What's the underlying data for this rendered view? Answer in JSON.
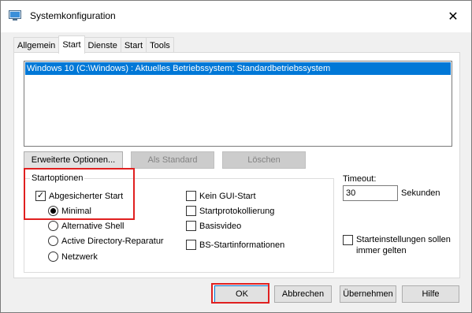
{
  "window": {
    "title": "Systemkonfiguration",
    "icon": "msconfig-icon"
  },
  "tabs": [
    {
      "label": "Allgemein",
      "active": false
    },
    {
      "label": "Start",
      "active": true
    },
    {
      "label": "Dienste",
      "active": false
    },
    {
      "label": "Start",
      "active": false
    },
    {
      "label": "Tools",
      "active": false
    }
  ],
  "os_list": {
    "items": [
      {
        "label": "Windows 10 (C:\\Windows) : Aktuelles Betriebssystem; Standardbetriebssystem",
        "selected": true
      }
    ]
  },
  "list_buttons": {
    "advanced": "Erweiterte Optionen...",
    "set_default": "Als Standard",
    "delete": "Löschen"
  },
  "startoptions": {
    "label": "Startoptionen",
    "safe_boot": {
      "label": "Abgesicherter Start",
      "checked": true
    },
    "radios": [
      {
        "label": "Minimal",
        "selected": true
      },
      {
        "label": "Alternative Shell",
        "selected": false
      },
      {
        "label": "Active Directory-Reparatur",
        "selected": false
      },
      {
        "label": "Netzwerk",
        "selected": false
      }
    ],
    "checkboxes": [
      {
        "label": "Kein GUI-Start",
        "checked": false
      },
      {
        "label": "Startprotokollierung",
        "checked": false
      },
      {
        "label": "Basisvideo",
        "checked": false
      },
      {
        "label": "BS-Startinformationen",
        "checked": false
      }
    ]
  },
  "timeout": {
    "label": "Timeout:",
    "value": "30",
    "unit": "Sekunden"
  },
  "persist": {
    "label": "Starteinstellungen sollen immer gelten",
    "checked": false
  },
  "footer": {
    "ok": "OK",
    "cancel": "Abbrechen",
    "apply": "Übernehmen",
    "help": "Hilfe"
  },
  "colors": {
    "selection": "#0078d7",
    "highlight": "#e02020"
  }
}
